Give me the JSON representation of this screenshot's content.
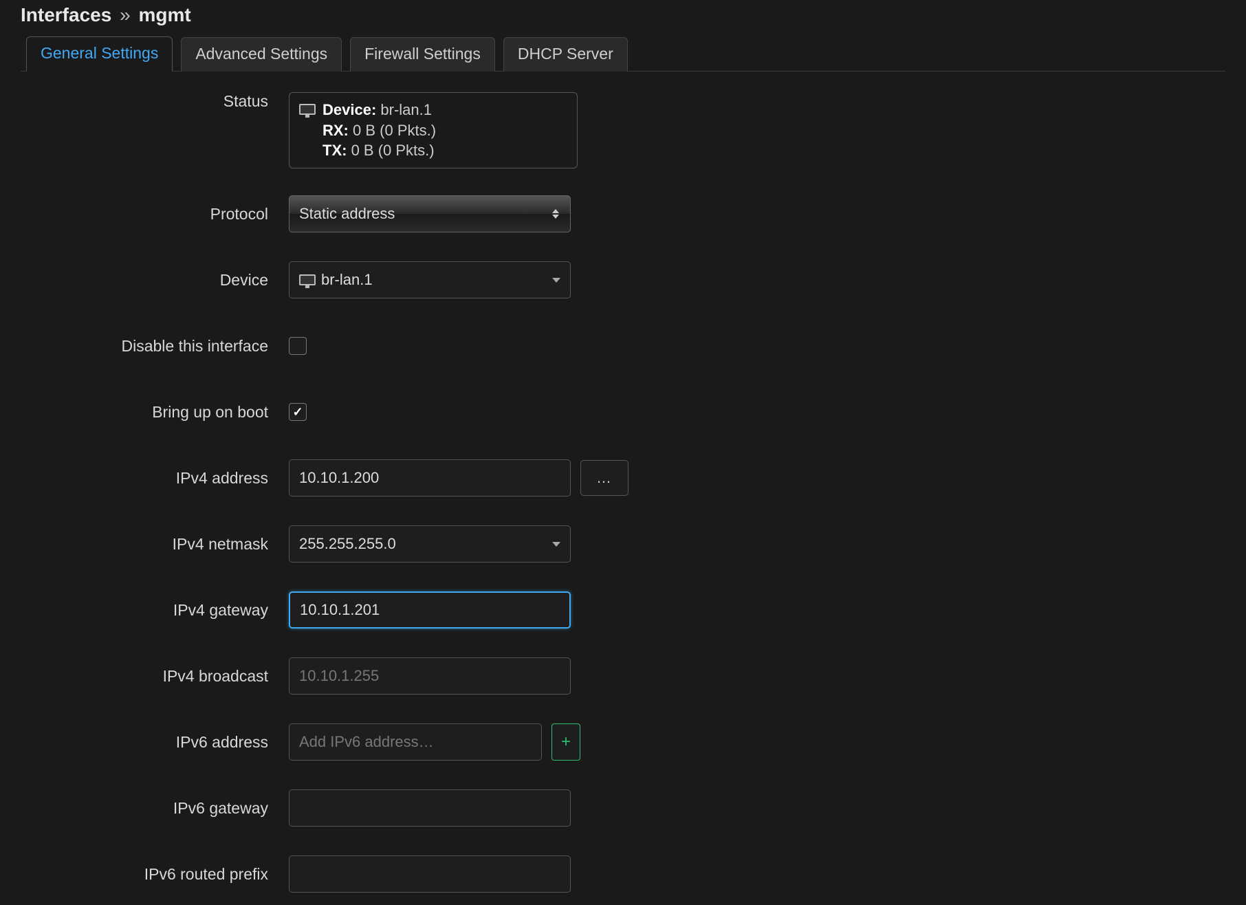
{
  "header": {
    "section": "Interfaces",
    "separator": "»",
    "name": "mgmt"
  },
  "tabs": {
    "general": "General Settings",
    "advanced": "Advanced Settings",
    "firewall": "Firewall Settings",
    "dhcp": "DHCP Server"
  },
  "labels": {
    "status": "Status",
    "protocol": "Protocol",
    "device": "Device",
    "disable": "Disable this interface",
    "bringup": "Bring up on boot",
    "ipv4address": "IPv4 address",
    "ipv4netmask": "IPv4 netmask",
    "ipv4gateway": "IPv4 gateway",
    "ipv4broadcast": "IPv4 broadcast",
    "ipv6address": "IPv6 address",
    "ipv6gateway": "IPv6 gateway",
    "ipv6routedprefix": "IPv6 routed prefix"
  },
  "status": {
    "deviceLabel": "Device:",
    "deviceValue": "br-lan.1",
    "rxLabel": "RX:",
    "rxValue": "0 B (0 Pkts.)",
    "txLabel": "TX:",
    "txValue": "0 B (0 Pkts.)"
  },
  "fields": {
    "protocol": "Static address",
    "device": "br-lan.1",
    "disable": false,
    "bringup": true,
    "ipv4address": "10.10.1.200",
    "ipv4netmask": "255.255.255.0",
    "ipv4gateway": "10.10.1.201",
    "ipv4broadcast": "",
    "ipv4broadcast_placeholder": "10.10.1.255",
    "ipv6address": "",
    "ipv6address_placeholder": "Add IPv6 address…",
    "ipv6gateway": "",
    "ipv6routedprefix": ""
  },
  "buttons": {
    "dots": "…",
    "plus": "+"
  }
}
